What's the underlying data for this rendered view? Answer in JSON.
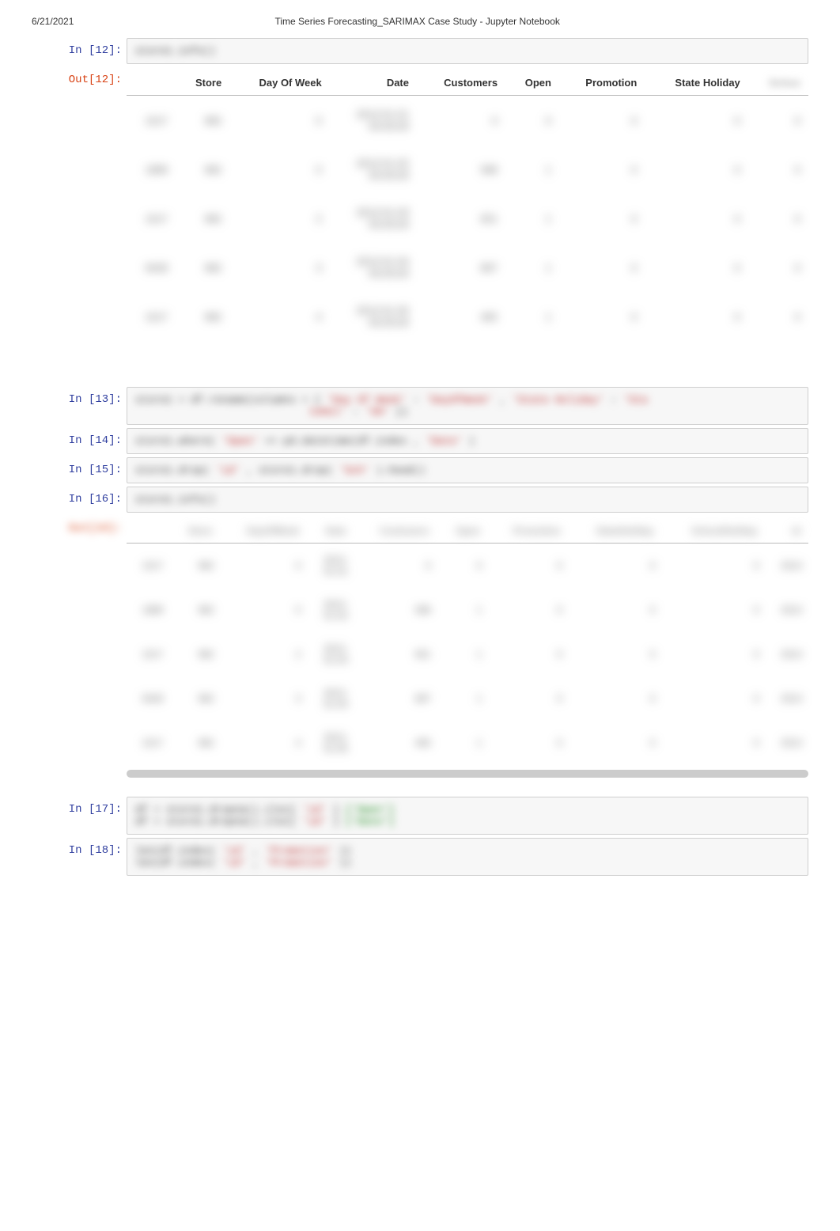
{
  "header": {
    "date": "6/21/2021",
    "title": "Time Series Forecasting_SARIMAX Case Study - Jupyter Notebook"
  },
  "prompts": {
    "in12": "In [12]:",
    "out12": "Out[12]:",
    "in13": "In [13]:",
    "in14": "In [14]:",
    "in15": "In [15]:",
    "in16": "In [16]:",
    "out16": "Out[16]:",
    "in17": "In [17]:",
    "in18": "In [18]:"
  },
  "code": {
    "c12": "store1.info()",
    "c13_a": "store1 = df.rename(columns",
    "c13_b": "= {",
    "c13_c": "'Day Of Week'",
    "c13_d": ":",
    "c13_e": "'DayOfWeek'",
    "c13_f": ",",
    "c13_g": "'State Holiday'",
    "c13_h": ":",
    "c13_i": "'Sta",
    "c13_line2a": "teHol'",
    "c13_line2b": ":",
    "c13_line2c": "'SH'",
    "c13_line2d": "})",
    "c14_a": "store1.where(",
    "c14_b": "'Open'",
    "c14_c": "==",
    "c14_d": "pd.datetime(df.index",
    "c14_e": ",",
    "c14_f": "'Date'",
    "c14_g": ")",
    "c15_a": "store1.drop(",
    "c15_b": "'id'",
    "c15_c": ",",
    "c15_d": "store1.drop(",
    "c15_e": "'Sch'",
    "c15_f": ").head()",
    "c16": "store1.info()",
    "c17_line1_a": "df = store1.dropna().iloc[",
    "c17_line1_b": "'id'",
    "c17_line1_c": "]",
    "c17_line1_d": "['Open']",
    "c17_line2_a": "df = store1.dropna().iloc[",
    "c17_line2_b": "'id'",
    "c17_line2_c": "]",
    "c17_line2_d": "['Date']",
    "c18_line1_a": "len(df.index(",
    "c18_line1_b": "'id'",
    "c18_line1_c": ",",
    "c18_line1_d": "'Promotion'",
    "c18_line1_e": "))",
    "c18_line2_a": "len(df.index(",
    "c18_line2_b": "'id'",
    "c18_line2_c": ",",
    "c18_line2_d": "'Promotion'",
    "c18_line2_e": "))"
  },
  "table12": {
    "headers": [
      "",
      "Store",
      "Day Of Week",
      "Date",
      "Customers",
      "Open",
      "Promotion",
      "State Holiday",
      "Schoo"
    ],
    "rows": [
      [
        "1017",
        "982",
        "0",
        "2013-01-01\n00:00:00",
        "0",
        "0",
        "0",
        "0",
        "0"
      ],
      [
        "1889",
        "982",
        "0",
        "2013-01-02\n00:00:00",
        "588",
        "1",
        "0",
        "0",
        "0"
      ],
      [
        "1017",
        "982",
        "2",
        "2013-01-03\n00:00:00",
        "651",
        "1",
        "0",
        "0",
        "0"
      ],
      [
        "9428",
        "982",
        "3",
        "2013-01-04\n00:00:00",
        "897",
        "1",
        "0",
        "0",
        "0"
      ],
      [
        "1017",
        "982",
        "4",
        "2013-01-05\n00:00:00",
        "465",
        "1",
        "0",
        "0",
        "0"
      ]
    ]
  },
  "table16": {
    "headers": [
      "",
      "Store",
      "DayOfWeek",
      "Date",
      "Customers",
      "Open",
      "Promotion",
      "StateHoliday",
      "SchoolHoliday",
      "id"
    ],
    "rows": [
      [
        "1017",
        "982",
        "0",
        "2013-\n01-01",
        "0",
        "0",
        "0",
        "0",
        "0",
        "2013"
      ],
      [
        "1889",
        "982",
        "0",
        "2013-\n01-02",
        "588",
        "1",
        "0",
        "0",
        "0",
        "2013"
      ],
      [
        "1017",
        "982",
        "2",
        "2013-\n01-03",
        "651",
        "1",
        "0",
        "0",
        "0",
        "2013"
      ],
      [
        "9428",
        "982",
        "3",
        "2013-\n01-04",
        "897",
        "1",
        "0",
        "0",
        "0",
        "2013"
      ],
      [
        "1017",
        "982",
        "4",
        "2013-\n01-05",
        "465",
        "1",
        "0",
        "0",
        "0",
        "2013"
      ]
    ]
  }
}
